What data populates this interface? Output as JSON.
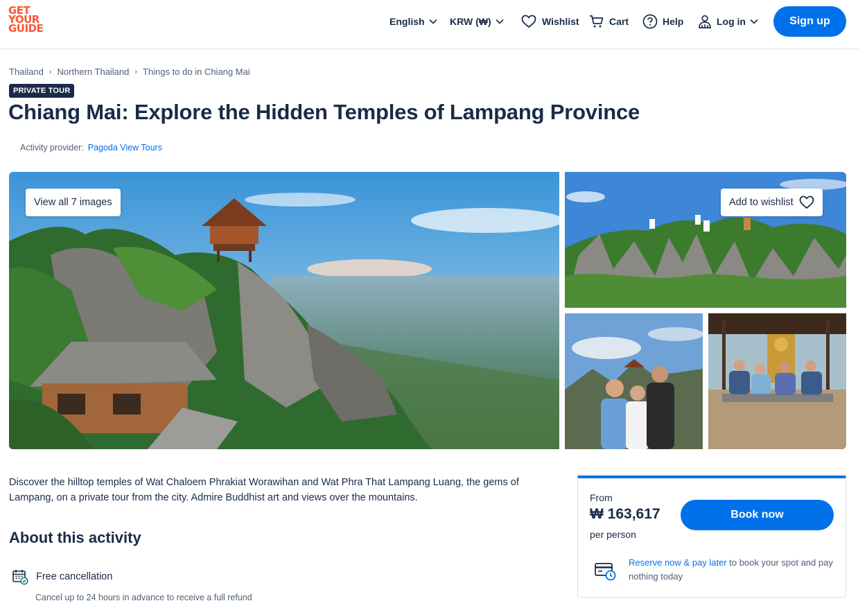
{
  "header": {
    "logo_lines": [
      "GET",
      "YOUR",
      "GUIDE"
    ],
    "language": "English",
    "currency": "KRW (₩)",
    "wishlist": "Wishlist",
    "cart": "Cart",
    "help": "Help",
    "login": "Log in",
    "signup": "Sign up"
  },
  "breadcrumb": [
    "Thailand",
    "Northern Thailand",
    "Things to do in Chiang Mai"
  ],
  "badge": "PRIVATE TOUR",
  "title": "Chiang Mai: Explore the Hidden Temples of Lampang Province",
  "provider": {
    "label": "Activity provider:",
    "name": "Pagoda View Tours"
  },
  "gallery": {
    "view_all": "View all 7 images",
    "add_wishlist": "Add to wishlist"
  },
  "description": "Discover the hilltop temples of Wat Chaloem Phrakiat Worawihan and Wat Phra That Lampang Luang, the gems of Lampang, on a private tour from the city. Admire Buddhist art and views over the mountains.",
  "about": {
    "heading": "About this activity",
    "features": [
      {
        "title": "Free cancellation",
        "subtitle": "Cancel up to 24 hours in advance to receive a full refund",
        "icon": "calendar-check-icon"
      }
    ]
  },
  "booking": {
    "from": "From",
    "price": "₩ 163,617",
    "per_person": "per person",
    "book_now": "Book now",
    "reserve_link": "Reserve now & pay later",
    "reserve_text": " to book your spot and pay nothing today"
  },
  "colors": {
    "brand_orange": "#ff5533",
    "primary_blue": "#0071eb",
    "navy": "#1a2b49"
  }
}
